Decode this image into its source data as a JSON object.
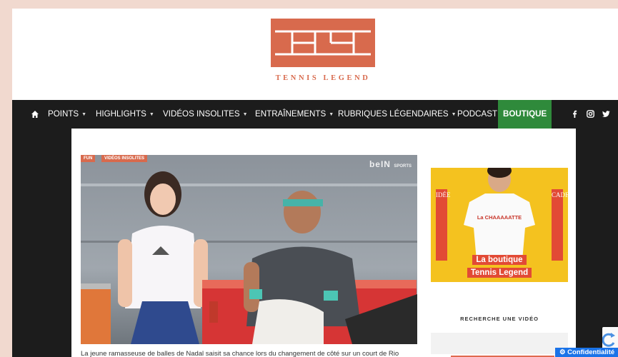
{
  "brand": {
    "logo_text": "TENNIS LEGEND",
    "primary_color": "#d86a4d"
  },
  "nav": {
    "items": [
      {
        "label": "POINTS",
        "has_caret": true
      },
      {
        "label": "HIGHLIGHTS",
        "has_caret": true
      },
      {
        "label": "VIDÉOS INSOLITES",
        "has_caret": true
      },
      {
        "label": "ENTRAÎNEMENTS",
        "has_caret": true
      },
      {
        "label": "RUBRIQUES LÉGENDAIRES",
        "has_caret": true
      },
      {
        "label": "PODCAST",
        "has_caret": false
      }
    ],
    "boutique_label": "BOUTIQUE",
    "caret": "▼",
    "social_icons": [
      "facebook-icon",
      "instagram-icon",
      "twitter-icon"
    ]
  },
  "article": {
    "tags": [
      "FUN",
      "VIDÉOS INSOLITES"
    ],
    "broadcaster": "beIN",
    "broadcaster_sub": "SPORTS",
    "caption": "La jeune ramasseuse de balles de Nadal saisit sa chance lors du changement de côté sur un court de Rio"
  },
  "sidebar": {
    "promo": {
      "left_word": "IDÉE",
      "right_word": "CADEAUX",
      "shirt_text": "La CHAAAAATTE",
      "line1": "La boutique",
      "line2": "Tennis Legend"
    },
    "search_title": "RECHERCHE UNE VIDÉO"
  },
  "footer_badges": {
    "privacy": "Confidentialité"
  }
}
